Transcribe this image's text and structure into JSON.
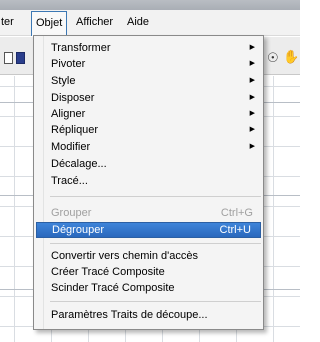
{
  "menubar": {
    "items": [
      {
        "label": "ter"
      },
      {
        "label": "Objet"
      },
      {
        "label": "Afficher"
      },
      {
        "label": "Aide"
      }
    ]
  },
  "toolbar": {
    "icons": [
      "page-icon",
      "color-swatch-icon",
      "zoom-icon",
      "hand-icon"
    ]
  },
  "menu": {
    "items": [
      {
        "label": "Transformer",
        "submenu": true
      },
      {
        "label": "Pivoter",
        "submenu": true
      },
      {
        "label": "Style",
        "submenu": true
      },
      {
        "label": "Disposer",
        "submenu": true
      },
      {
        "label": "Aligner",
        "submenu": true
      },
      {
        "label": "Répliquer",
        "submenu": true
      },
      {
        "label": "Modifier",
        "submenu": true
      },
      {
        "label": "Décalage..."
      },
      {
        "label": "Tracé..."
      },
      {
        "label": "Grouper",
        "shortcut": "Ctrl+G",
        "disabled": true
      },
      {
        "label": "Dégrouper",
        "shortcut": "Ctrl+U",
        "highlighted": true
      },
      {
        "label": "Convertir vers chemin d'accès"
      },
      {
        "label": "Créer Tracé Composite"
      },
      {
        "label": "Scinder Tracé Composite"
      },
      {
        "label": "Paramètres Traits de découpe..."
      }
    ]
  },
  "colors": {
    "highlight": "#2f73c9",
    "menu_bg": "#f4f4f4",
    "disabled_text": "#a0a0a0"
  }
}
